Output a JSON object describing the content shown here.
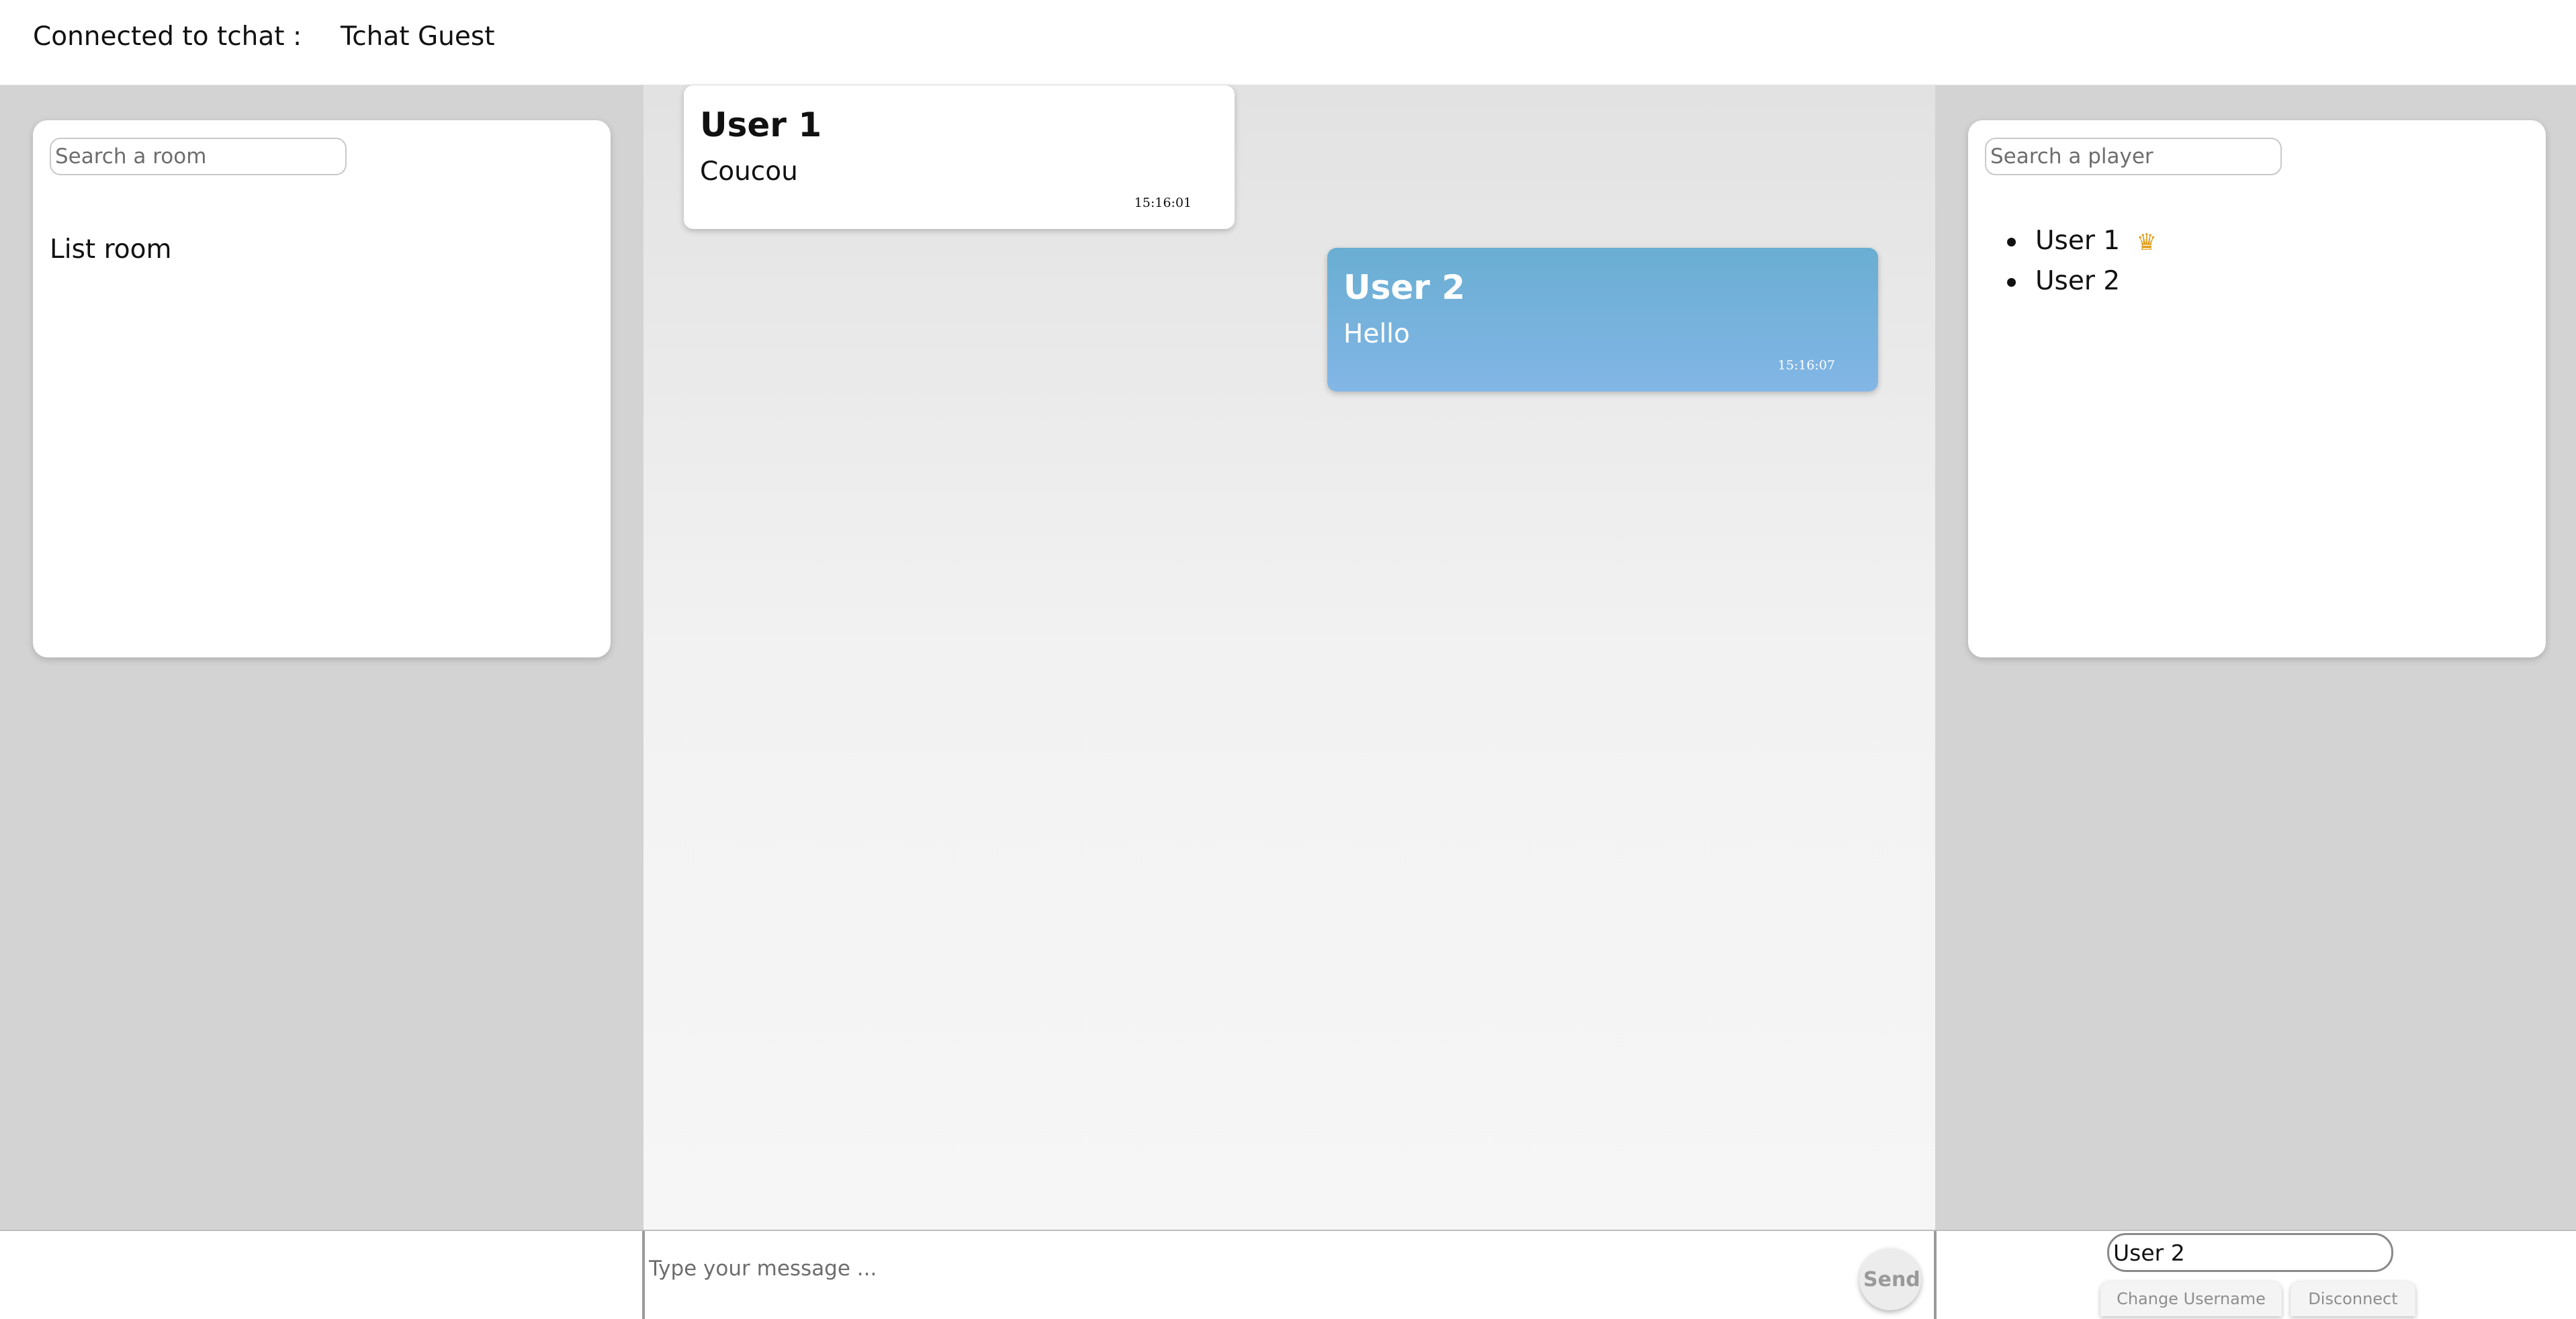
{
  "header": {
    "connected_label": "Connected to tchat :",
    "room_name": "Tchat Guest"
  },
  "rooms_panel": {
    "search_placeholder": "Search a room",
    "title": "List room"
  },
  "players_panel": {
    "search_placeholder": "Search a player",
    "players": [
      {
        "name": "User 1",
        "crown_icon": "crown-icon",
        "is_owner": true
      },
      {
        "name": "User 2",
        "is_owner": false
      }
    ]
  },
  "messages": [
    {
      "user": "User 1",
      "text": "Coucou",
      "time": "15:16:01",
      "own": false
    },
    {
      "user": "User 2",
      "text": "Hello",
      "time": "15:16:07",
      "own": true
    }
  ],
  "composer": {
    "placeholder": "Type your message ...",
    "send_label": "Send"
  },
  "account": {
    "username_value": "User 2",
    "change_username_label": "Change Username",
    "disconnect_label": "Disconnect"
  },
  "colors": {
    "own_bubble_top": "#6aaed2",
    "own_bubble_bottom": "#82b6e6",
    "side_background": "#d3d3d3"
  }
}
